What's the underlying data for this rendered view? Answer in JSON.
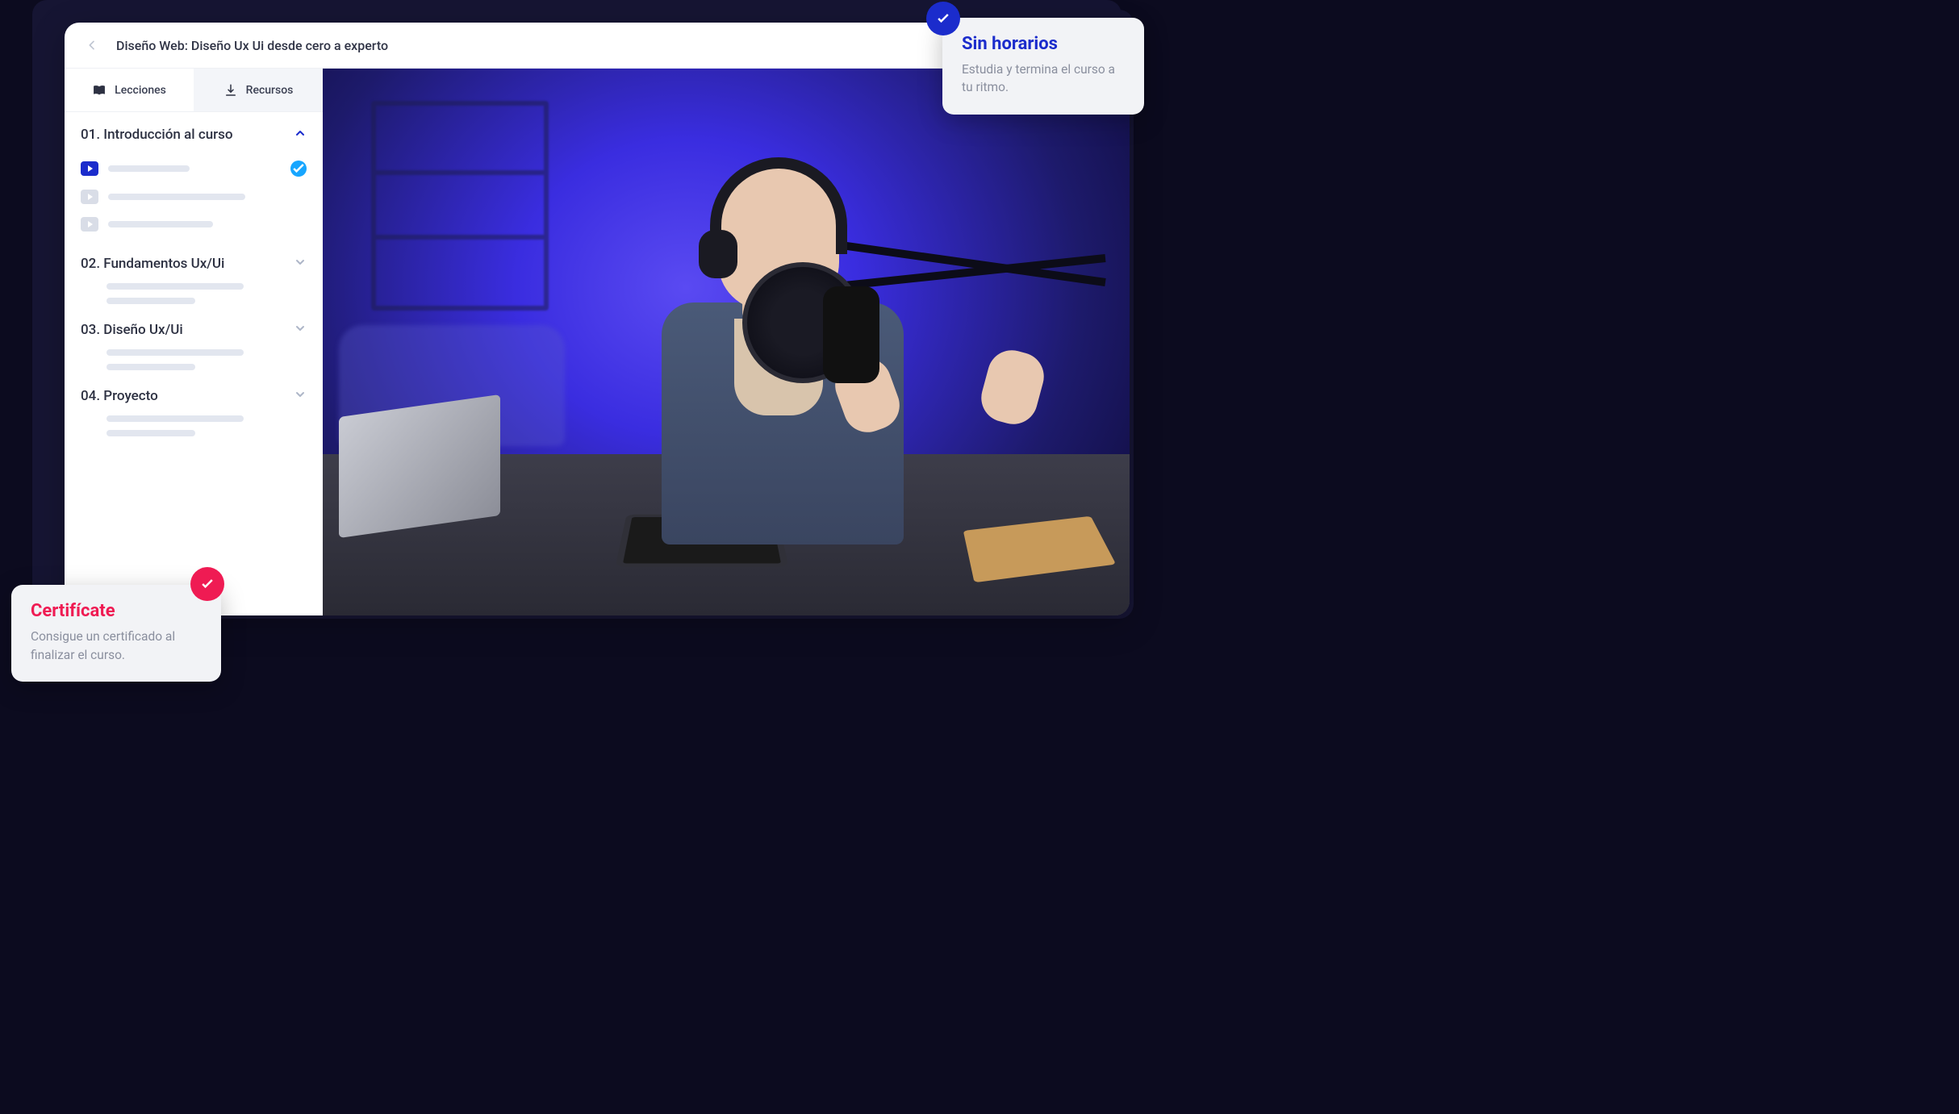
{
  "header": {
    "course_title": "Diseño Web: Diseño Ux Ui desde cero a experto"
  },
  "tabs": {
    "lessons": "Lecciones",
    "resources": "Recursos"
  },
  "sections": [
    {
      "title": "01. Introducción al curso",
      "expanded": true
    },
    {
      "title": "02. Fundamentos Ux/Ui",
      "expanded": false
    },
    {
      "title": "03. Diseño Ux/Ui",
      "expanded": false
    },
    {
      "title": "04. Proyecto",
      "expanded": false
    }
  ],
  "callouts": {
    "top_right": {
      "title": "Sin horarios",
      "body": "Estudia y termina el curso a tu ritmo."
    },
    "bottom_left": {
      "title": "Certifícate",
      "body": "Consigue un certificado al finalizar el curso."
    }
  }
}
